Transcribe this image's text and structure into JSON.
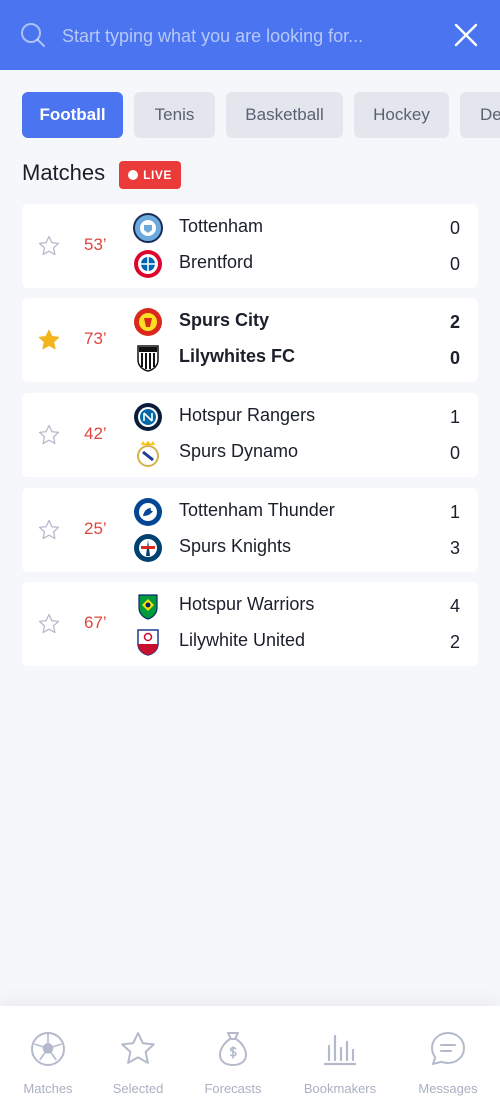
{
  "colors": {
    "accent": "#4a74f0",
    "live": "#ea3a3a",
    "minute": "#e0453f",
    "star_active": "#f2b51c",
    "muted": "#aab0c2"
  },
  "search": {
    "placeholder": "Start typing what you are looking for...",
    "value": ""
  },
  "tabs": [
    {
      "label": "Football",
      "active": true
    },
    {
      "label": "Tenis",
      "active": false
    },
    {
      "label": "Basketball",
      "active": false
    },
    {
      "label": "Hockey",
      "active": false
    },
    {
      "label": "De",
      "active": false
    }
  ],
  "section": {
    "title": "Matches",
    "live_label": "LIVE"
  },
  "matches": [
    {
      "minute": "53’",
      "favorite": false,
      "home": "Tottenham",
      "away": "Brentford",
      "home_score": "0",
      "away_score": "0",
      "home_logo": "city-crest-icon",
      "away_logo": "bayern-crest-icon"
    },
    {
      "minute": "73’",
      "favorite": true,
      "home": "Spurs City",
      "away": "Lilywhites FC",
      "home_score": "2",
      "away_score": "0",
      "home_logo": "devil-crest-icon",
      "away_logo": "striped-crest-icon"
    },
    {
      "minute": "42’",
      "favorite": false,
      "home": "Hotspur Rangers",
      "away": "Spurs Dynamo",
      "home_score": "1",
      "away_score": "0",
      "home_logo": "inter-crest-icon",
      "away_logo": "royal-crest-icon"
    },
    {
      "minute": "25’",
      "favorite": false,
      "home": "Tottenham Thunder",
      "away": "Spurs Knights",
      "home_score": "1",
      "away_score": "3",
      "home_logo": "lion-crest-icon",
      "away_logo": "paris-crest-icon"
    },
    {
      "minute": "67’",
      "favorite": false,
      "home": "Hotspur Warriors",
      "away": "Lilywhite United",
      "home_score": "4",
      "away_score": "2",
      "home_logo": "brazil-crest-icon",
      "away_logo": "shield-crest-icon"
    }
  ],
  "bottom_nav": [
    {
      "label": "Matches",
      "icon": "soccer-ball-icon"
    },
    {
      "label": "Selected",
      "icon": "star-icon"
    },
    {
      "label": "Forecasts",
      "icon": "money-bag-icon"
    },
    {
      "label": "Bookmakers",
      "icon": "bar-chart-icon"
    },
    {
      "label": "Messages",
      "icon": "chat-bubble-icon"
    }
  ]
}
